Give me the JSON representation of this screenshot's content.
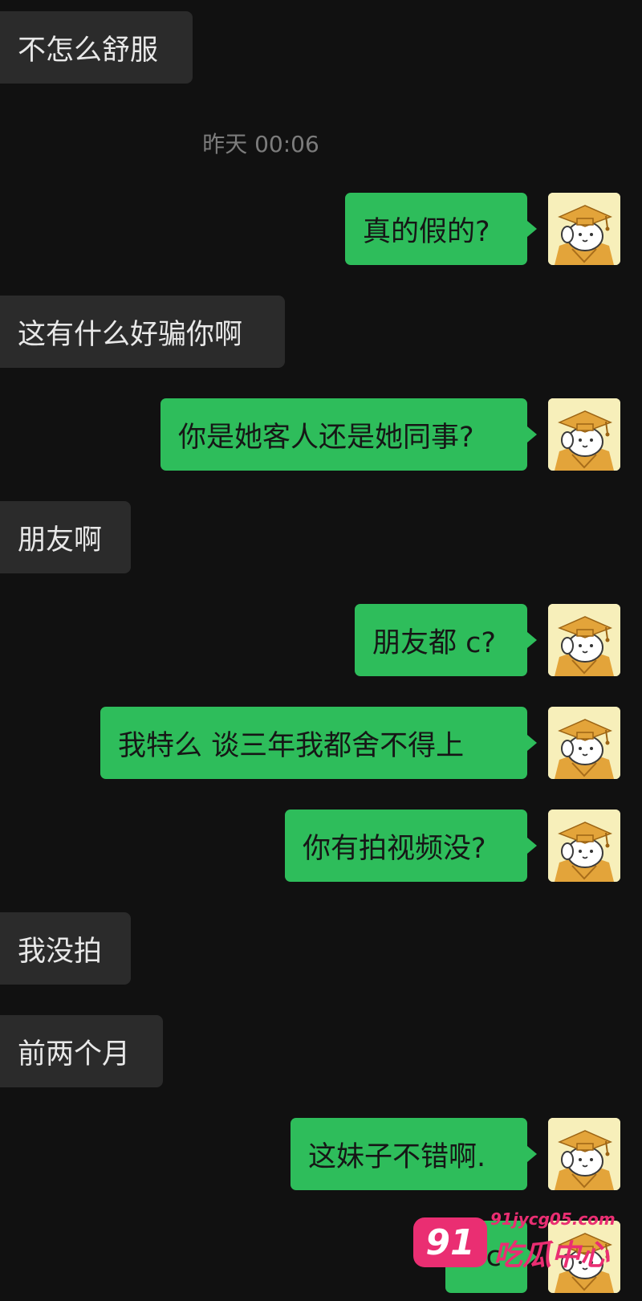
{
  "timestamp": "昨天 00:06",
  "messages": [
    {
      "side": "in",
      "text": "不怎么舒服"
    },
    {
      "side": "out",
      "text": "真的假的?"
    },
    {
      "side": "in",
      "text": "这有什么好骗你啊"
    },
    {
      "side": "out",
      "text": "你是她客人还是她同事?"
    },
    {
      "side": "in",
      "text": "朋友啊"
    },
    {
      "side": "out",
      "text": "朋友都 c?"
    },
    {
      "side": "out",
      "text": "我特么 谈三年我都舍不得上"
    },
    {
      "side": "out",
      "text": "你有拍视频没?"
    },
    {
      "side": "in",
      "text": "我没拍"
    },
    {
      "side": "in",
      "text": "前两个月"
    },
    {
      "side": "out",
      "text": "这妹子不错啊."
    },
    {
      "side": "out",
      "text": "wc"
    }
  ],
  "avatar": {
    "icon": "graduate-dog-avatar",
    "bg_color": "#f7efba"
  },
  "watermark": {
    "badge": "91",
    "url": "91jycg05.com",
    "name": "吃瓜中心",
    "color": "#ea2e72"
  },
  "colors": {
    "background": "#111111",
    "incoming_bubble": "#2b2b2b",
    "outgoing_bubble": "#2ebd5b",
    "timestamp": "#7c7c7c"
  }
}
